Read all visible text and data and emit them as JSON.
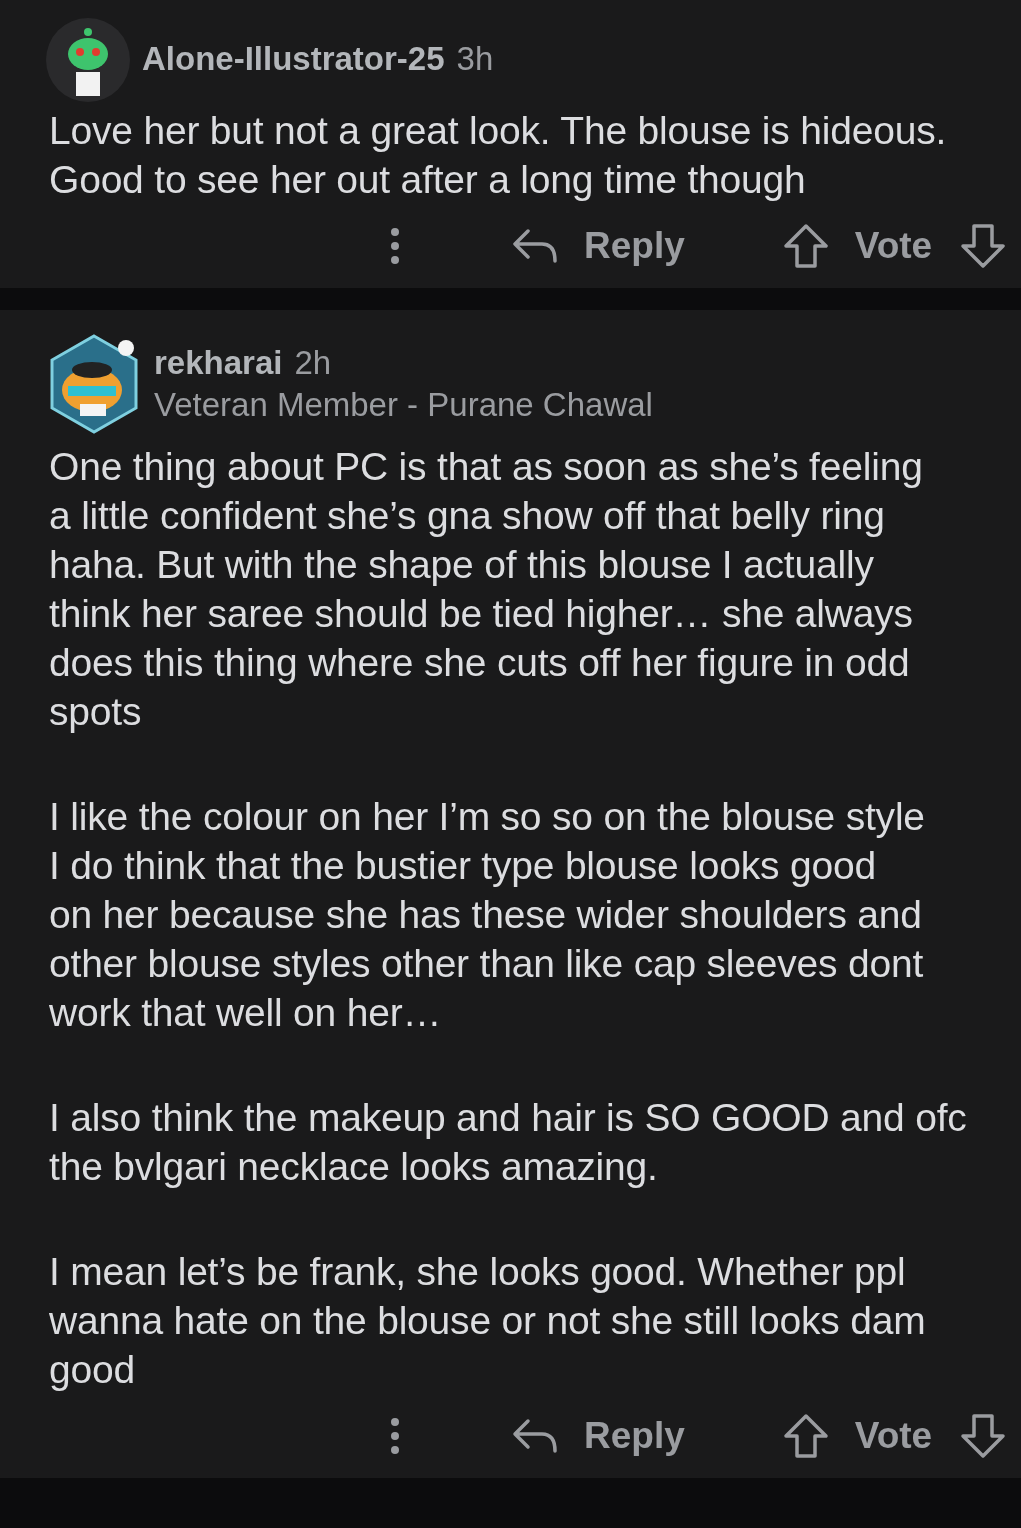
{
  "comments": [
    {
      "avatar": {
        "kind": "snoo"
      },
      "username": "Alone-Illustrator-25",
      "age": "3h",
      "paragraphs": [
        [
          "Love her but not a great look. The blouse is hideous.",
          "Good to see her out after a long time though"
        ]
      ],
      "reply": "Reply",
      "vote": "Vote"
    },
    {
      "avatar": {
        "kind": "hex"
      },
      "username": "rekharai",
      "age": "2h",
      "flair": "Veteran Member - Purane Chawal",
      "paragraphs": [
        [
          "One thing about PC is that as soon as she’s feeling",
          "a little confident she’s gna show off that belly ring",
          "haha. But with the shape of this blouse I actually",
          "think her saree should be tied higher… she always",
          "does this thing where she cuts off her figure in odd",
          "spots"
        ],
        [
          "I like the colour on her I’m so so on the blouse style",
          "I do think that the bustier type blouse looks good",
          "on her because she has these wider shoulders and",
          "other blouse styles other than like cap sleeves dont",
          "work that well on her…"
        ],
        [
          "I also think the makeup and hair is SO GOOD and ofc",
          "the bvlgari necklace looks amazing."
        ],
        [
          "I mean let’s be frank, she looks good. Whether ppl",
          "wanna hate on the blouse or not she still looks dam",
          "good"
        ]
      ],
      "reply": "Reply",
      "vote": "Vote"
    }
  ]
}
